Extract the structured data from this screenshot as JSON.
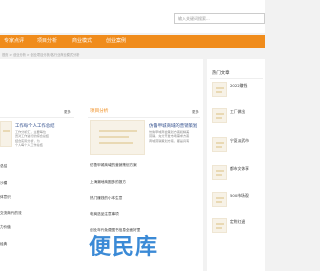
{
  "search": {
    "placeholder": "输入关键词搜索..."
  },
  "nav": {
    "items": [
      "专家点评",
      "项目分析",
      "商业模式",
      "创业案例"
    ]
  },
  "breadcrumb": "首页 > 创业分析 > 创业项目分析/各行业商业模式分析",
  "left_panel": {
    "title": "",
    "more": "更多",
    "featured_title": "工作每个人工作总结",
    "featured_desc": [
      "工作分析汇，主要每位",
      "员对工作进行的综合总结",
      "结合实际分析，为",
      "个人每个人工作总结"
    ],
    "list": [
      "总结",
      "沙模",
      "体意识",
      "交流商代的流",
      "力价值",
      "经典"
    ]
  },
  "mid_panel": {
    "title": "项目分析",
    "more": "更多",
    "featured_title": "仿鲁甲城商域的营销策划",
    "featured_desc": [
      "仿鲁甲域商会策划方案和精美",
      "营销，充分开发市场需求方案",
      "商城营销策划方案，都是具有"
    ],
    "list": [
      "仿鲁甲城商域的营销策划方案",
      "上海潮地商圈多的报方",
      "热门赚钱的小本生意",
      "电商选品注意事项",
      "创业年代免费图书信息全面好里"
    ]
  },
  "hot": {
    "title": "热门文章",
    "items": [
      {
        "title": "2022赚钱",
        "date": ""
      },
      {
        "title": "工厂做出",
        "date": ""
      },
      {
        "title": "宁夏淡武市",
        "date": ""
      },
      {
        "title": "都市文休享",
        "date": ""
      },
      {
        "title": "500市场观",
        "date": ""
      },
      {
        "title": "定附红退",
        "date": ""
      }
    ]
  },
  "watermark": "便民库"
}
